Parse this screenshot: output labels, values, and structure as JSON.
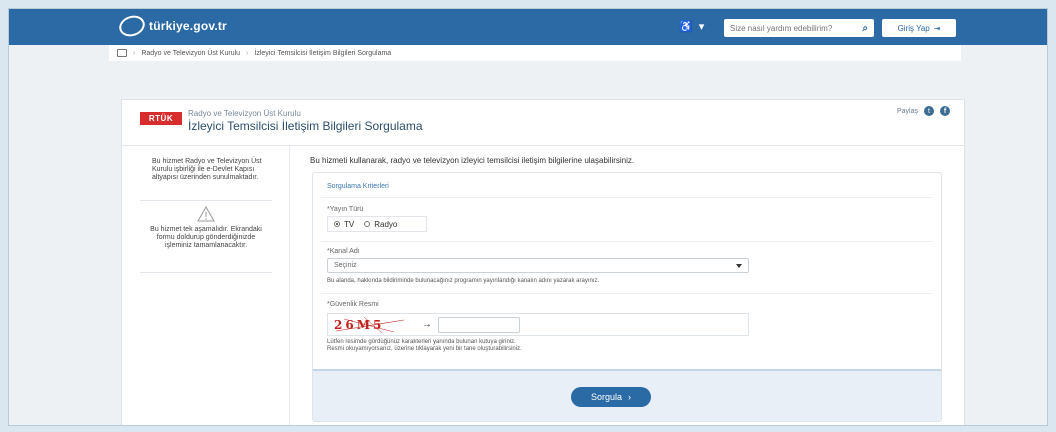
{
  "header": {
    "logo_text": "türkiye.gov.tr",
    "accessibility_symbol": "♿",
    "search_placeholder": "Size nasıl yardım edebilirim?",
    "login_label": "Giriş Yap"
  },
  "breadcrumb": {
    "items": [
      "Radyo ve Televizyon Üst Kurulu",
      "İzleyici Temsilcisi İletişim Bilgileri Sorgulama"
    ]
  },
  "panel": {
    "logo": "RTÜK",
    "institution": "Radyo ve Televizyon Üst Kurulu",
    "title": "İzleyici Temsilcisi İletişim Bilgileri Sorgulama",
    "share_label": "Paylaş"
  },
  "sidebar": {
    "info_text": "Bu hizmet Radyo ve Televizyon Üst Kurulu işbirliği ile e-Devlet Kapısı altyapısı üzerinden sunulmaktadır.",
    "stage_text": "Bu hizmet tek aşamalıdır. Ekrandaki formu doldurup gönderdiğinizde işleminiz tamamlanacaktır."
  },
  "form": {
    "intro": "Bu hizmeti kullanarak, radyo ve televizyon izleyici temsilcisi iletişim bilgilerine ulaşabilirsiniz.",
    "section_title": "Sorgulama Kriterleri",
    "broadcast_label": "*Yayın Türü",
    "radio_tv": "TV",
    "radio_radyo": "Radyo",
    "channel_label": "*Kanal Adı",
    "channel_value": "Seçiniz",
    "channel_help": "Bu alanda, hakkında bildiriminde bulunacağınız programın yayınlandığı kanalın adını yazarak arayınız.",
    "captcha_label": "*Güvenlik Resmi",
    "captcha_text": "26M5",
    "captcha_help_1": "Lütfen resimde gördüğünüz karakterleri yanında bulunan kutuya giriniz.",
    "captcha_help_2": "Resmi okuyamıyorsanız, üzerine tıklayarak yeni bir tane oluşturabilirsiniz.",
    "submit_label": "Sorgula"
  }
}
